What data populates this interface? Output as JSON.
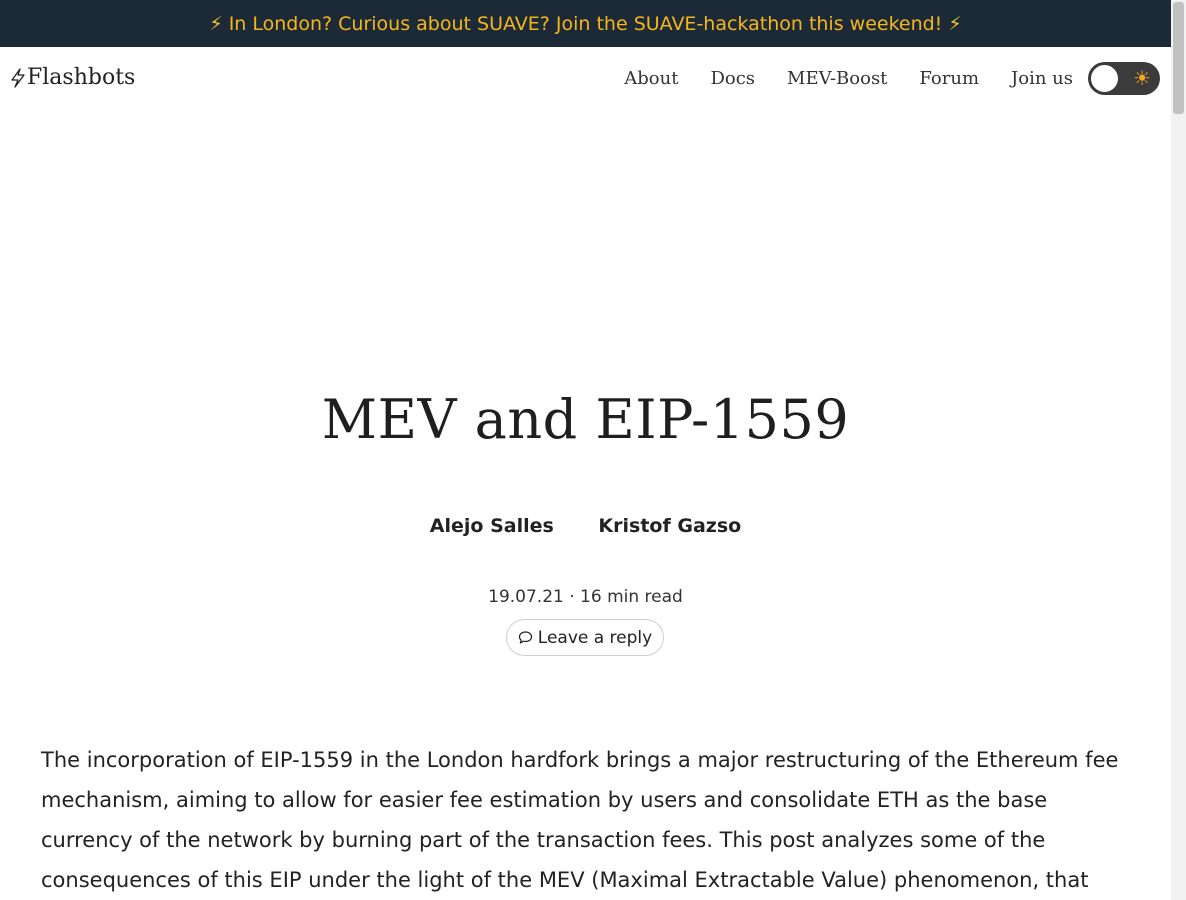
{
  "banner": {
    "text": "In London? Curious about SUAVE? Join the SUAVE-hackathon this weekend!",
    "icon": "lightning-icon"
  },
  "nav": {
    "logo": "Flashbots",
    "links": [
      "About",
      "Docs",
      "MEV-Boost",
      "Forum",
      "Join us"
    ],
    "theme_toggle_icon": "sun-icon"
  },
  "article": {
    "title": "MEV and EIP-1559",
    "authors": [
      "Alejo Salles",
      "Kristof Gazso"
    ],
    "meta": "19.07.21 · 16 min read",
    "reply_label": "Leave a reply",
    "body": "The incorporation of EIP-1559 in the London hardfork brings a major restructuring of the Ethereum fee mechanism, aiming to allow for easier fee estimation by users and consolidate ETH as the base currency of the network by burning part of the transaction fees. This post analyzes some of the consequences of this EIP under the light of the MEV (Maximal Extractable Value) phenomenon, that"
  }
}
